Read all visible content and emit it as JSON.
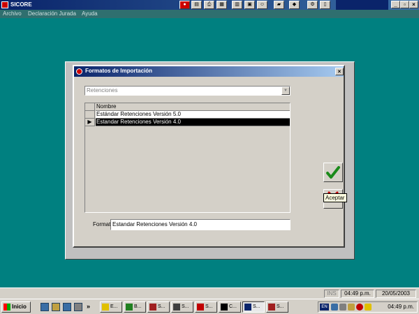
{
  "app": {
    "title": "SICORE"
  },
  "menu": {
    "items": [
      {
        "label": "Archivo"
      },
      {
        "label": "Declaración Jurada"
      },
      {
        "label": "Ayuda"
      }
    ]
  },
  "window_controls": {
    "minimize": "_",
    "restore": "▫",
    "close": "×"
  },
  "dialog": {
    "title": "Formatos de Importación",
    "close_glyph": "×",
    "combo_value": "Retenciones",
    "combo_arrow": "▼",
    "grid": {
      "column_header": "Nombre",
      "rows": [
        {
          "name": "Estándar Retenciones Versión 5.0",
          "selected": false
        },
        {
          "name": "Estandar Retenciones Versión 4.0",
          "selected": true
        }
      ],
      "row_indicator": "▶"
    },
    "format_label": "Formato:",
    "format_value": "Estandar Retenciones Versión 4.0",
    "tooltip": "Aceptar",
    "colors": {
      "accept_check": "#1a8a1a",
      "cancel_x": "#c00000"
    }
  },
  "status": {
    "mode": "INS",
    "time": "04:49 p.m.",
    "date": "20/05/2003"
  },
  "taskbar": {
    "start_label": "Inicio",
    "overflow": "»",
    "tasks": [
      {
        "label": "E...",
        "active": false
      },
      {
        "label": "B...",
        "active": false
      },
      {
        "label": "S...",
        "active": false
      },
      {
        "label": "S...",
        "active": false
      },
      {
        "label": "S...",
        "active": false
      },
      {
        "label": "C...",
        "active": false
      },
      {
        "label": "S...",
        "active": true
      },
      {
        "label": "S...",
        "active": false
      }
    ],
    "tray_lang": "EN",
    "clock": "04:49 p.m."
  }
}
